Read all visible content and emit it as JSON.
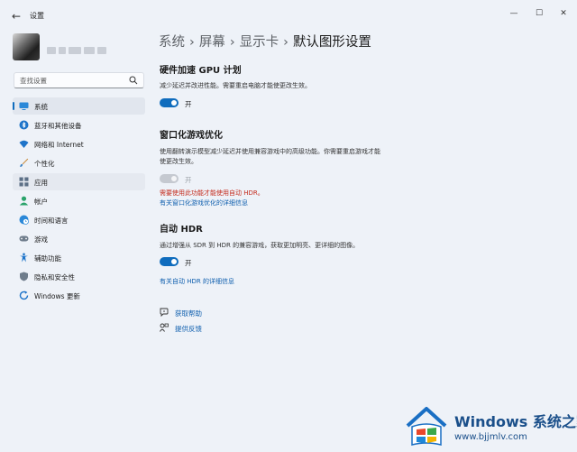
{
  "window": {
    "back_glyph": "←",
    "app_title": "设置",
    "min_glyph": "—",
    "max_glyph": "☐",
    "close_glyph": "✕"
  },
  "search": {
    "placeholder": "查找设置",
    "icon": "search-icon"
  },
  "sidebar": {
    "items": [
      {
        "label": "系统",
        "icon": "monitor-icon",
        "active": true
      },
      {
        "label": "蓝牙和其他设备",
        "icon": "bluetooth-icon"
      },
      {
        "label": "网络和 Internet",
        "icon": "wifi-icon"
      },
      {
        "label": "个性化",
        "icon": "brush-icon"
      },
      {
        "label": "应用",
        "icon": "apps-icon"
      },
      {
        "label": "帐户",
        "icon": "account-icon"
      },
      {
        "label": "时间和语言",
        "icon": "globe-clock-icon"
      },
      {
        "label": "游戏",
        "icon": "gamepad-icon"
      },
      {
        "label": "辅助功能",
        "icon": "accessibility-icon"
      },
      {
        "label": "隐私和安全性",
        "icon": "shield-icon"
      },
      {
        "label": "Windows 更新",
        "icon": "update-icon"
      }
    ]
  },
  "breadcrumb": {
    "items": [
      "系统",
      "屏幕",
      "显示卡",
      "默认图形设置"
    ],
    "separator": "›"
  },
  "sections": {
    "gpu_scheduling": {
      "title": "硬件加速 GPU 计划",
      "description": "减少延迟并改进性能。需要重启电脑才能使更改生效。",
      "toggle_state": "on",
      "toggle_label": "开"
    },
    "windowed_games": {
      "title": "窗口化游戏优化",
      "description": "使用翻转演示模型减少延迟并使用兼容游戏中的高级功能。你需要重启游戏才能使更改生效。",
      "toggle_state": "disabled",
      "toggle_label": "开",
      "warning": "需要使用此功能才能使用自动 HDR。",
      "link": "有关窗口化游戏优化的详细信息"
    },
    "auto_hdr": {
      "title": "自动 HDR",
      "description": "通过增强从 SDR 到 HDR 的兼容游戏，获取更加明亮、更详细的图像。",
      "toggle_state": "on",
      "toggle_label": "开",
      "link": "有关自动 HDR 的详细信息"
    }
  },
  "help": {
    "get_help": "获取帮助",
    "feedback": "提供反馈"
  },
  "watermark": {
    "title": "Windows 系统之家",
    "url": "www.bjjmlv.com"
  },
  "colors": {
    "accent": "#0f6cbd",
    "warning": "#c42b1c",
    "link": "#0f5fae",
    "background": "#eef2f8"
  }
}
